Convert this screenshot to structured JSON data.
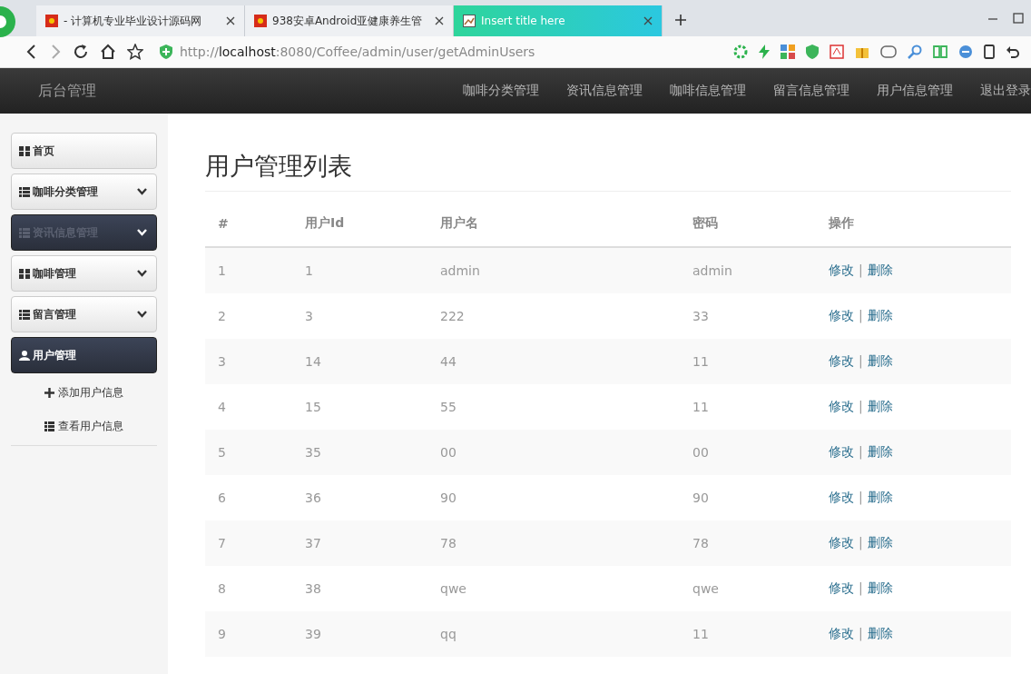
{
  "browser": {
    "tabs": [
      {
        "title": "- 计算机专业毕业设计源码网",
        "selected": false
      },
      {
        "title": "938安卓Android亚健康养生管",
        "selected": false
      },
      {
        "title": "Insert title here",
        "selected": true
      }
    ],
    "url": "http://**localhost**:8080/Coffee/admin/user/getAdminUsers"
  },
  "navbar": {
    "brand": "后台管理",
    "links": [
      "咖啡分类管理",
      "资讯信息管理",
      "咖啡信息管理",
      "留言信息管理",
      "用户信息管理",
      "退出登录"
    ]
  },
  "sidebar": {
    "items": [
      {
        "label": "首页",
        "kind": "link",
        "active": false
      },
      {
        "label": "咖啡分类管理",
        "kind": "dropdown",
        "active": false
      },
      {
        "label": "资讯信息管理",
        "kind": "dropdown",
        "active": true
      },
      {
        "label": "咖啡管理",
        "kind": "dropdown",
        "active": false
      },
      {
        "label": "留言管理",
        "kind": "dropdown",
        "active": false
      },
      {
        "label": "用户管理",
        "kind": "link",
        "active": true,
        "children": [
          {
            "label": "添加用户信息"
          },
          {
            "label": "查看用户信息"
          }
        ]
      }
    ]
  },
  "page_title": "用户管理列表",
  "table": {
    "columns": [
      "#",
      "用户Id",
      "用户名",
      "密码",
      "操作"
    ],
    "rows": [
      {
        "cells": [
          "1",
          "1",
          "admin",
          "admin"
        ],
        "actions": [
          "修改",
          "|",
          "删除"
        ]
      },
      {
        "cells": [
          "2",
          "3",
          "222",
          "33"
        ],
        "actions": [
          "修改",
          "|",
          "删除"
        ]
      },
      {
        "cells": [
          "3",
          "14",
          "44",
          "11"
        ],
        "actions": [
          "修改",
          "|",
          "删除"
        ]
      },
      {
        "cells": [
          "4",
          "15",
          "55",
          "11"
        ],
        "actions": [
          "修改",
          "|",
          "删除"
        ]
      },
      {
        "cells": [
          "5",
          "35",
          "00",
          "00"
        ],
        "actions": [
          "修改",
          "|",
          "删除"
        ]
      },
      {
        "cells": [
          "6",
          "36",
          "90",
          "90"
        ],
        "actions": [
          "修改",
          "|",
          "删除"
        ]
      },
      {
        "cells": [
          "7",
          "37",
          "78",
          "78"
        ],
        "actions": [
          "修改",
          "|",
          "删除"
        ]
      },
      {
        "cells": [
          "8",
          "38",
          "qwe",
          "qwe"
        ],
        "actions": [
          "修改",
          "|",
          "删除"
        ]
      },
      {
        "cells": [
          "9",
          "39",
          "qq",
          "11"
        ],
        "actions": [
          "修改",
          "|",
          "删除"
        ]
      }
    ]
  }
}
